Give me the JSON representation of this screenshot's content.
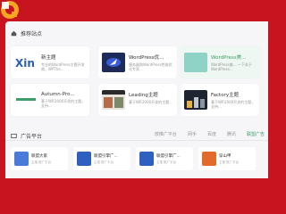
{
  "colors": {
    "brand": "#c8141e",
    "accent": "#3c9f68",
    "panel": "#f6f6f8"
  },
  "section1": {
    "icon": "home-icon",
    "title": "推荐站点"
  },
  "cards": [
    {
      "title": "新主题",
      "desc": "专业的WordPress主题开发商，WPThe...",
      "thumb": "xin-logo"
    },
    {
      "title": "WordPress优...",
      "desc": "服务器和WordPress性能优化专家...",
      "thumb": "rocket-logo"
    },
    {
      "title": "WordPress美...",
      "desc": "WordPress美... 一下关于 WordPress...",
      "thumb": "teal-image"
    },
    {
      "title": "Autumn-Pro...",
      "desc": "基于WP.2000开发的主题，支持...",
      "thumb": "autumn-logo"
    },
    {
      "title": "Leading主题",
      "desc": "基于WP.2000开发的主题...",
      "thumb": "leading-screenshot"
    },
    {
      "title": "Factory主题",
      "desc": "基于WP.2000开发的主题，支持...",
      "thumb": "factory-screenshot"
    }
  ],
  "section2": {
    "icon": "ad-icon",
    "title": "广告平台"
  },
  "tabs": [
    "按推广平台",
    "网手",
    "百度",
    "腾讯",
    "联盟广告"
  ],
  "minis": [
    {
      "title": "联盟大家",
      "desc": "主推 推广平台"
    },
    {
      "title": "联盟引擎广...",
      "desc": "主推 推广平台"
    },
    {
      "title": "联盟引擎广...",
      "desc": "主推 推广平台"
    },
    {
      "title": "穿山甲",
      "desc": "主推 推广平台"
    }
  ]
}
